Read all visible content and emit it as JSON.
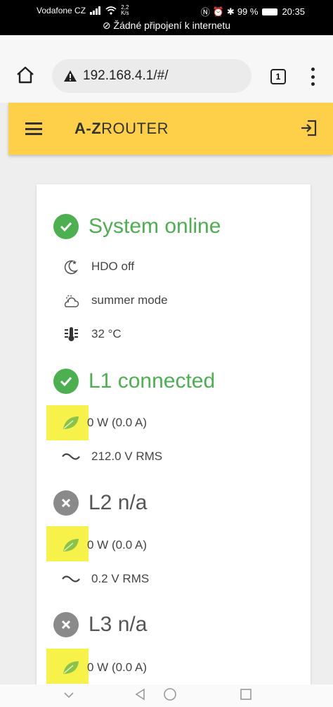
{
  "status_bar": {
    "carrier": "Vodafone CZ",
    "speed_value": "2,2",
    "speed_unit": "K/s",
    "battery": "99 %",
    "time": "20:35",
    "network_notice": "Žádné připojení k internetu"
  },
  "browser": {
    "url": "192.168.4.1/#/",
    "tab_count": "1"
  },
  "app": {
    "brand_bold": "A-Z",
    "brand_rest": "ROUTER"
  },
  "system": {
    "title": "System online",
    "hdo": "HDO off",
    "mode": "summer mode",
    "temperature": "32 °C"
  },
  "phases": [
    {
      "title": "L1 connected",
      "state": "ok",
      "power": "0 W (0.0 A)",
      "voltage": "212.0 V RMS"
    },
    {
      "title": "L2 n/a",
      "state": "na",
      "power": "0 W (0.0 A)",
      "voltage": "0.2 V RMS"
    },
    {
      "title": "L3 n/a",
      "state": "na",
      "power": "0 W (0.0 A)"
    }
  ],
  "colors": {
    "accent_yellow": "#fed049",
    "ok_green": "#4caf50",
    "na_gray": "#8a8a8a",
    "highlight": "#f7f24a",
    "leaf_green": "#8bc34a"
  }
}
